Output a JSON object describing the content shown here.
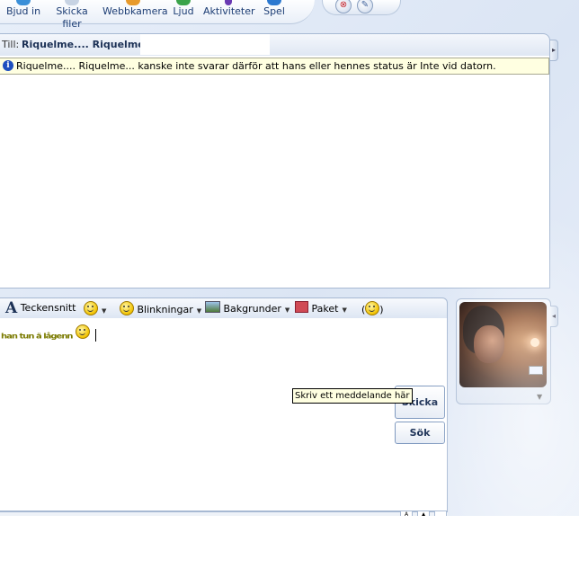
{
  "toolbar": {
    "items": [
      {
        "label": "Bjud in",
        "icon": "invite-icon"
      },
      {
        "label": "Skicka filer",
        "icon": "send-files-icon"
      },
      {
        "label": "Webbkamera",
        "icon": "webcam-icon"
      },
      {
        "label": "Ljud",
        "icon": "audio-icon"
      },
      {
        "label": "Aktiviteter",
        "icon": "activities-icon"
      },
      {
        "label": "Spel",
        "icon": "games-icon"
      }
    ]
  },
  "conversation": {
    "to_label": "Till:",
    "to_name": "Riquelme.... Riquelme...",
    "info_message": "Riquelme.... Riquelme... kanske inte svarar därför att hans eller hennes status är Inte vid datorn."
  },
  "format_bar": {
    "font_label": "Teckensnitt",
    "winks_label": "Blinkningar",
    "backgrounds_label": "Bakgrunder",
    "packages_label": "Paket"
  },
  "compose": {
    "typed_text": "han tun ä lågenn"
  },
  "buttons": {
    "send": "Skicka",
    "search": "Sök"
  },
  "tooltip": "Skriv ett meddelande här",
  "colors": {
    "info_bg": "#ffffe1",
    "accent": "#1c3156"
  }
}
